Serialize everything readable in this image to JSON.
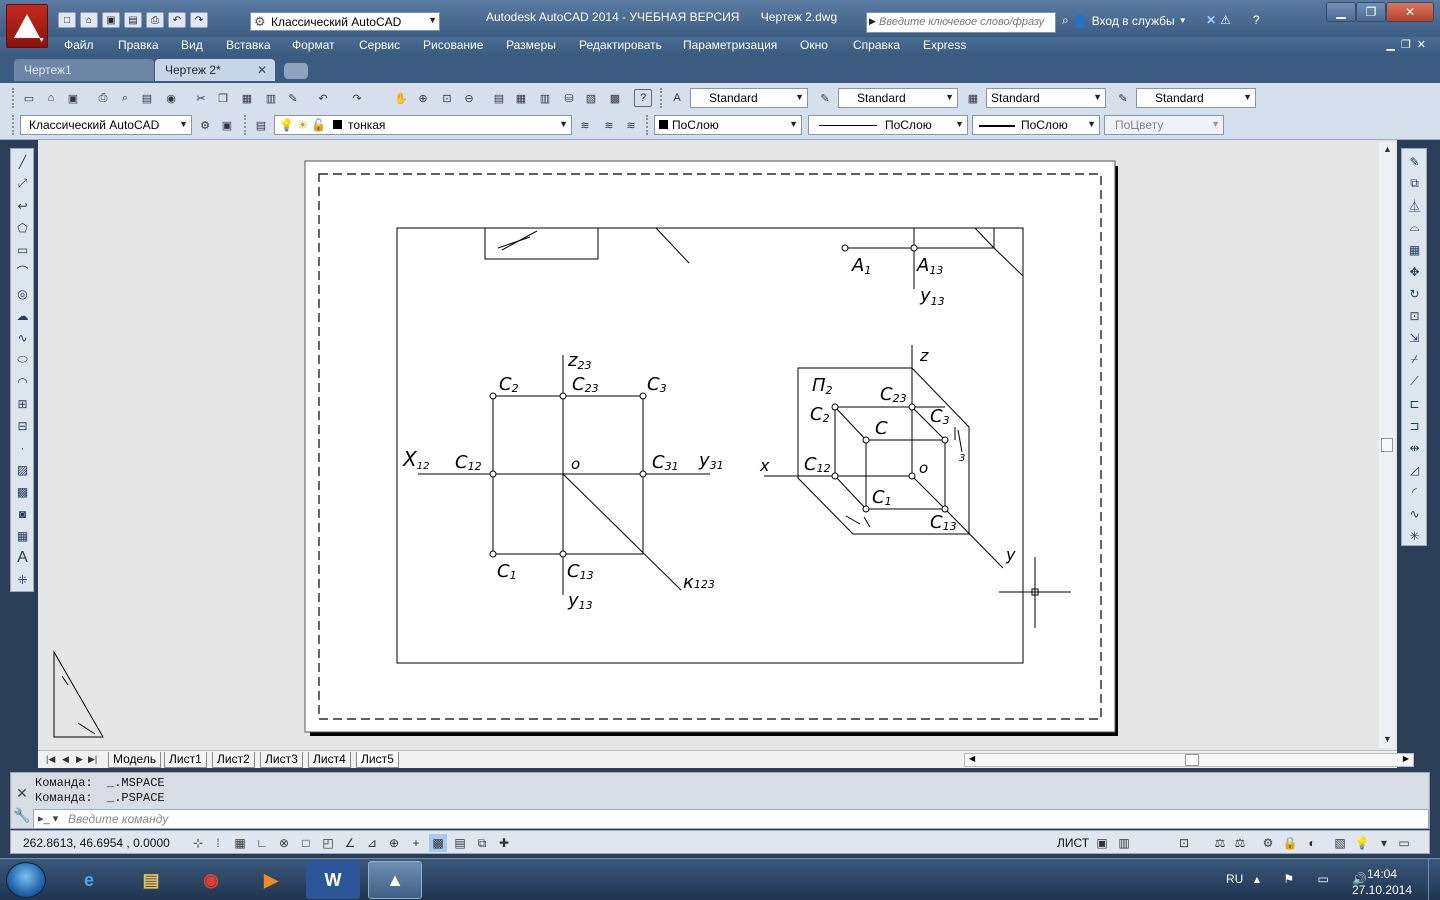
{
  "window": {
    "title": "Autodesk AutoCAD 2014 - УЧЕБНАЯ ВЕРСИЯ",
    "filename": "Чертеж 2.dwg",
    "workspace": "Классический AutoCAD",
    "search_placeholder": "Введите ключевое слово/фразу",
    "signin": "Вход в службы"
  },
  "menu": [
    "Файл",
    "Правка",
    "Вид",
    "Вставка",
    "Формат",
    "Сервис",
    "Рисование",
    "Размеры",
    "Редактировать",
    "Параметризация",
    "Окно",
    "Справка",
    "Express"
  ],
  "file_tabs": [
    {
      "label": "Чертеж1",
      "active": false
    },
    {
      "label": "Чертеж 2*",
      "active": true
    }
  ],
  "styles": {
    "text_style": "Standard",
    "dim_style": "Standard",
    "table_style": "Standard",
    "mleader_style": "Standard"
  },
  "properties": {
    "workspace": "Классический AutoCAD",
    "layer": "тонкая",
    "color": "ПоСлою",
    "linetype": "ПоСлою",
    "lineweight": "ПоСлою",
    "plotstyle": "ПоЦвету"
  },
  "layout_tabs": [
    "Модель",
    "Лист1",
    "Лист2",
    "Лист3",
    "Лист4",
    "Лист5"
  ],
  "active_layout": "Лист5",
  "command_history": [
    "Команда:  _.MSPACE",
    "Команда:  _.PSPACE"
  ],
  "command_placeholder": "Введите команду",
  "status": {
    "coordinates": "262.8613, 46.6954 , 0.0000",
    "space": "ЛИСТ"
  },
  "taskbar": {
    "lang": "RU",
    "time": "14:04",
    "date": "27.10.2014"
  },
  "drawing": {
    "left_view": {
      "z": "z",
      "z_sub": "23",
      "x": "X",
      "x_sub": "12",
      "y31": "y",
      "y31_sub": "31",
      "y13": "y",
      "y13_sub": "13",
      "k": "к",
      "k_sub": "123",
      "o": "o",
      "c2": "C",
      "c2_sub": "2",
      "c23": "C",
      "c23_sub": "23",
      "c3": "C",
      "c3_sub": "3",
      "c12": "C",
      "c12_sub": "12",
      "c31": "C",
      "c31_sub": "31",
      "c1": "C",
      "c1_sub": "1",
      "c13": "C",
      "c13_sub": "13"
    },
    "top_right": {
      "a1": "A",
      "a1_sub": "1",
      "a13": "A",
      "a13_sub": "13",
      "y13": "y",
      "y13_sub": "13"
    },
    "iso_view": {
      "z": "z",
      "x": "x",
      "y": "y",
      "pi2": "П",
      "pi2_sub": "2",
      "c": "C",
      "o": "o",
      "c2": "C",
      "c2_sub": "2",
      "c23": "C",
      "c23_sub": "23",
      "c3": "C",
      "c3_sub": "3",
      "c12": "C",
      "c12_sub": "12",
      "c1": "C",
      "c1_sub": "1",
      "c13": "C",
      "c13_sub": "13",
      "p3_sub": "3"
    }
  }
}
